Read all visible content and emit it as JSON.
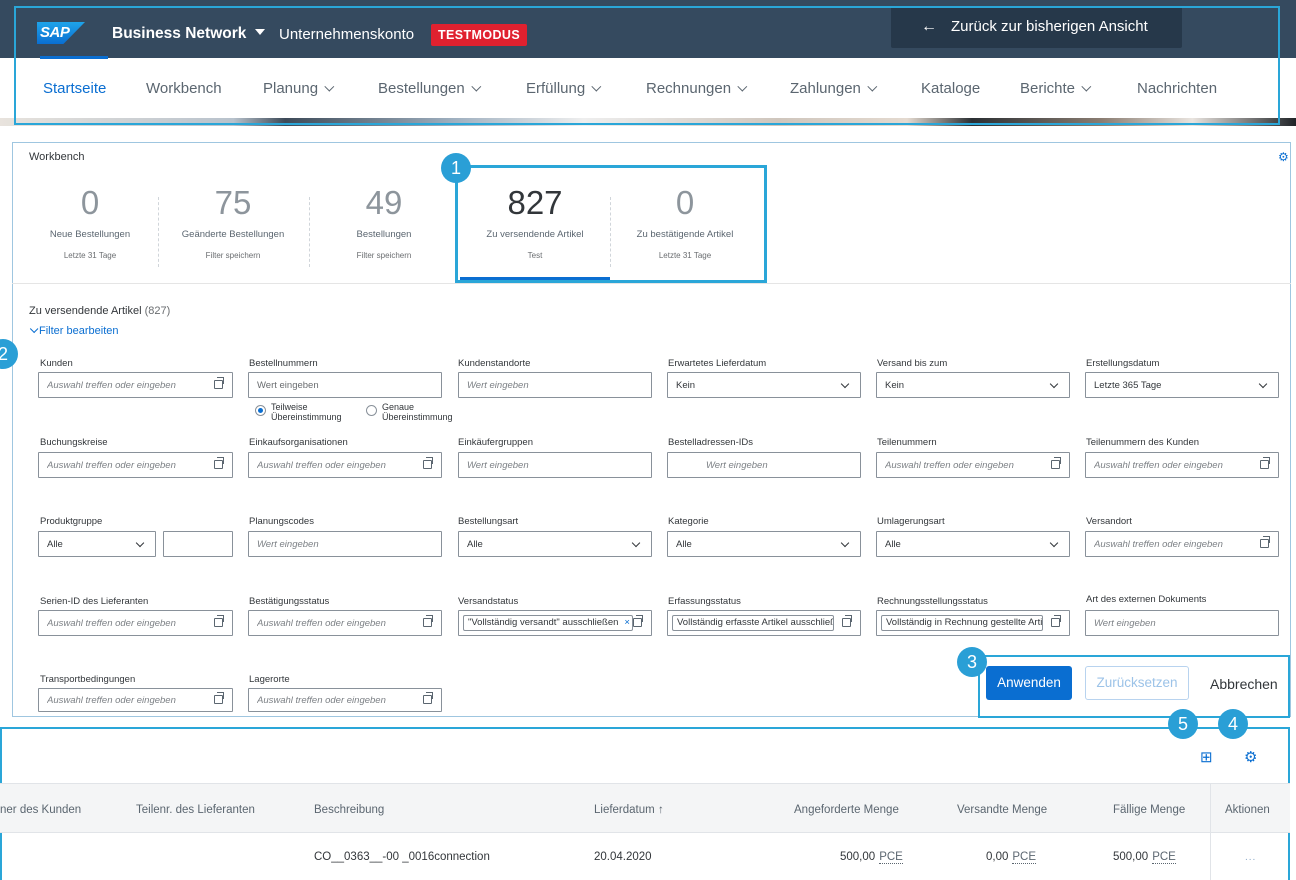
{
  "shell": {
    "logo": "SAP",
    "product": "Business Network",
    "account": "Unternehmenskonto",
    "mode_badge": "TESTMODUS",
    "back_button": "Zurück zur bisherigen Ansicht"
  },
  "nav": {
    "items": [
      {
        "label": "Startseite",
        "dropdown": false,
        "active": true
      },
      {
        "label": "Workbench",
        "dropdown": false
      },
      {
        "label": "Planung",
        "dropdown": true
      },
      {
        "label": "Bestellungen",
        "dropdown": true
      },
      {
        "label": "Erfüllung",
        "dropdown": true
      },
      {
        "label": "Rechnungen",
        "dropdown": true
      },
      {
        "label": "Zahlungen",
        "dropdown": true
      },
      {
        "label": "Kataloge",
        "dropdown": false
      },
      {
        "label": "Berichte",
        "dropdown": true
      },
      {
        "label": "Nachrichten",
        "dropdown": false
      }
    ]
  },
  "workbench": {
    "title": "Workbench",
    "tiles": [
      {
        "value": "0",
        "label": "Neue Bestellungen",
        "sub": "Letzte 31 Tage"
      },
      {
        "value": "75",
        "label": "Geänderte Bestellungen",
        "sub": "Filter speichern"
      },
      {
        "value": "49",
        "label": "Bestellungen",
        "sub": "Filter speichern"
      },
      {
        "value": "827",
        "label": "Zu versendende Artikel",
        "sub": "Test",
        "selected": true
      },
      {
        "value": "0",
        "label": "Zu bestätigende Artikel",
        "sub": "Letzte 31 Tage"
      }
    ]
  },
  "filter": {
    "section_title": "Zu versendende Artikel",
    "section_count": "(827)",
    "toggle": "Filter bearbeiten",
    "fields": {
      "kunden": {
        "label": "Kunden",
        "placeholder": "Auswahl treffen oder eingeben"
      },
      "bestellnummern": {
        "label": "Bestellnummern",
        "placeholder": "Wert eingeben"
      },
      "radio_partial": "Teilweise Übereinstimmung",
      "radio_exact": "Genaue Übereinstimmung",
      "kundenstandorte": {
        "label": "Kundenstandorte",
        "placeholder": "Wert eingeben"
      },
      "lieferdatum": {
        "label": "Erwartetes Lieferdatum",
        "value": "Kein"
      },
      "versand_bis": {
        "label": "Versand bis zum",
        "value": "Kein"
      },
      "erstellungsdatum": {
        "label": "Erstellungsdatum",
        "value": "Letzte 365 Tage"
      },
      "buchungskreise": {
        "label": "Buchungskreise",
        "placeholder": "Auswahl treffen oder eingeben"
      },
      "einkaufsorg": {
        "label": "Einkaufsorganisationen",
        "placeholder": "Auswahl treffen oder eingeben"
      },
      "einkaeufergruppen": {
        "label": "Einkäufergruppen",
        "placeholder": "Wert eingeben"
      },
      "bestelladressen": {
        "label": "Bestelladressen-IDs",
        "placeholder": "Wert eingeben"
      },
      "teilenummern": {
        "label": "Teilenummern",
        "placeholder": "Auswahl treffen oder eingeben"
      },
      "teilenummern_kunden": {
        "label": "Teilenummern des Kunden",
        "placeholder": "Auswahl treffen oder eingeben"
      },
      "produktgruppe": {
        "label": "Produktgruppe",
        "value": "Alle"
      },
      "planungscodes": {
        "label": "Planungscodes",
        "placeholder": "Wert eingeben"
      },
      "bestellungsart": {
        "label": "Bestellungsart",
        "value": "Alle"
      },
      "kategorie": {
        "label": "Kategorie",
        "value": "Alle"
      },
      "umlagerungsart": {
        "label": "Umlagerungsart",
        "value": "Alle"
      },
      "versandort": {
        "label": "Versandort",
        "placeholder": "Auswahl treffen oder eingeben"
      },
      "serien_id": {
        "label": "Serien-ID des Lieferanten",
        "placeholder": "Auswahl treffen oder eingeben"
      },
      "bestaetigungsstatus": {
        "label": "Bestätigungsstatus",
        "placeholder": "Auswahl treffen oder eingeben"
      },
      "versandstatus": {
        "label": "Versandstatus",
        "token": "\"Vollständig versandt\" ausschließen"
      },
      "erfassungsstatus": {
        "label": "Erfassungsstatus",
        "token": "Vollständig erfasste Artikel ausschließen"
      },
      "rechnungsstatus": {
        "label": "Rechnungsstellungsstatus",
        "token": "Vollständig in Rechnung gestellte Artikel"
      },
      "externes_dokument": {
        "label": "Art des externen Dokuments",
        "placeholder": "Wert eingeben"
      },
      "transportbedingungen": {
        "label": "Transportbedingungen",
        "placeholder": "Auswahl treffen oder eingeben"
      },
      "lagerorte": {
        "label": "Lagerorte",
        "placeholder": "Auswahl treffen oder eingeben"
      }
    },
    "buttons": {
      "apply": "Anwenden",
      "reset": "Zurücksetzen",
      "cancel": "Abbrechen"
    }
  },
  "table": {
    "columns": [
      "ner des Kunden",
      "Teilenr. des Lieferanten",
      "Beschreibung",
      "Lieferdatum",
      "Angeforderte Menge",
      "Versandte Menge",
      "Fällige Menge",
      "Aktionen"
    ],
    "sort_indicator": "↑",
    "rows": [
      {
        "beschreibung": "CO__0363__-00 _0016connection",
        "lieferdatum": "20.04.2020",
        "angefordert": "500,00",
        "versandt": "0,00",
        "faellig": "500,00",
        "unit": "PCE",
        "action": "..."
      }
    ]
  },
  "callouts": [
    "1",
    "2",
    "3",
    "4",
    "5"
  ],
  "colors": {
    "accent": "#0a6ed1",
    "shell": "#354a5f",
    "callout": "#2a9fd6",
    "badge": "#e0212f"
  }
}
